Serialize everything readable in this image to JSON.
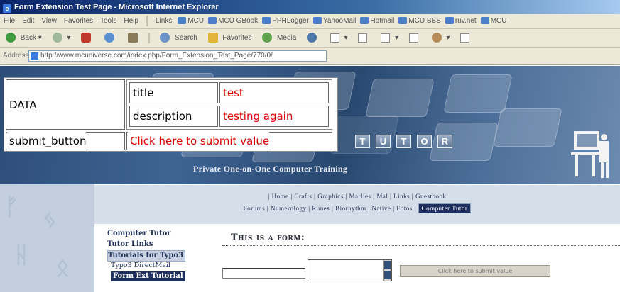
{
  "window": {
    "title": "Form Extension Test Page - Microsoft Internet Explorer"
  },
  "menu": [
    "File",
    "Edit",
    "View",
    "Favorites",
    "Tools",
    "Help"
  ],
  "links_label": "Links",
  "links": [
    "MCU",
    "MCU GBook",
    "PPHLogger",
    "YahooMail",
    "Hotmail",
    "MCU BBS",
    "ruv.net",
    "MCU"
  ],
  "toolbar": {
    "back": "Back",
    "search": "Search",
    "favorites": "Favorites",
    "media": "Media"
  },
  "address": {
    "label": "Address",
    "url": "http://www.mcuniverse.com/index.php/Form_Extension_Test_Page/770/0/"
  },
  "overlay": {
    "data_label": "DATA",
    "title_key": "title",
    "title_value": "test",
    "description_key": "description",
    "description_value": "testing again",
    "submit_key": "submit_button",
    "submit_value": "Click here to submit value"
  },
  "banner": {
    "logo_letters": [
      "T",
      "U",
      "T",
      "O",
      "R"
    ],
    "tagline": "Private One-on-One Computer Training"
  },
  "nav": {
    "row1": [
      "Home",
      "Crafts",
      "Graphics",
      "Marlies",
      "Mal",
      "Links",
      "Guestbook"
    ],
    "row2": [
      "Forums",
      "Numerology",
      "Runes",
      "Biorhythm",
      "Native",
      "Fotos"
    ],
    "active": "Computer Tutor"
  },
  "sidenav": {
    "computer_tutor": "Computer Tutor",
    "tutor_links": "Tutor Links",
    "tutorials_typo3": "Tutorials for Typo3",
    "typo3_directmail": "Typo3 DirectMail",
    "form_ext_tutorial": "Form Ext Tutorial"
  },
  "form": {
    "heading": "This is a form:",
    "submit_label": "Click here to submit value"
  },
  "colors": {
    "title_bar": "#0a246a",
    "value_text": "#e00000",
    "banner": "#3f6493",
    "nav_active": "#1e2f5d"
  }
}
